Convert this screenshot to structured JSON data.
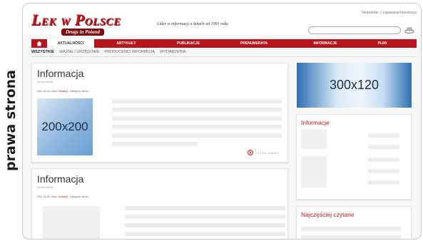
{
  "side_label": "prawa strona",
  "site": {
    "logo_main": "Lek w Polsce",
    "logo_sub": "Drugs in Poland",
    "tagline": "Lider w informacji o lekach od 1991 roku",
    "top_links": {
      "newsletter": "Newsletter",
      "login": "logowanie/rejestracja"
    }
  },
  "nav": {
    "home_icon": "home-icon",
    "items": [
      {
        "label": "AKTUALNOŚCI"
      },
      {
        "label": "ARTYKUŁY"
      },
      {
        "label": "PUBLIKACJE"
      },
      {
        "label": "PRENUMERATA"
      },
      {
        "label": "INFORMACJE"
      },
      {
        "label": "PLIKI"
      }
    ]
  },
  "subnav": {
    "items": [
      {
        "label": "WSZYSTKIE"
      },
      {
        "label": "WAŻNE I URZĘDOWE"
      },
      {
        "label": "PRODUCENCI INFORMUJĄ"
      },
      {
        "label": "WYDARZENIA"
      }
    ]
  },
  "articles": [
    {
      "title": "Informacja",
      "subtitle": "(credo tekst)",
      "meta_date": "2011-04-05, Autor:",
      "meta_author": "redakcja",
      "meta_cat": ", Kategoria: News",
      "ad_label": "200x200",
      "read_more": "CZYTAJ DALEJ"
    },
    {
      "title": "Informacja",
      "subtitle": "(credo tekst)",
      "meta_date": "2011-04-05, Autor:",
      "meta_author": "redakcja",
      "meta_cat": ", Kategoria: News"
    }
  ],
  "sidebar": {
    "ad_label": "300x120",
    "box1_title": "Informacje",
    "box2_title": "Najczęściej czytane"
  },
  "colors": {
    "brand_red": "#b8141c",
    "ad_blue": "#6b9ed3"
  }
}
